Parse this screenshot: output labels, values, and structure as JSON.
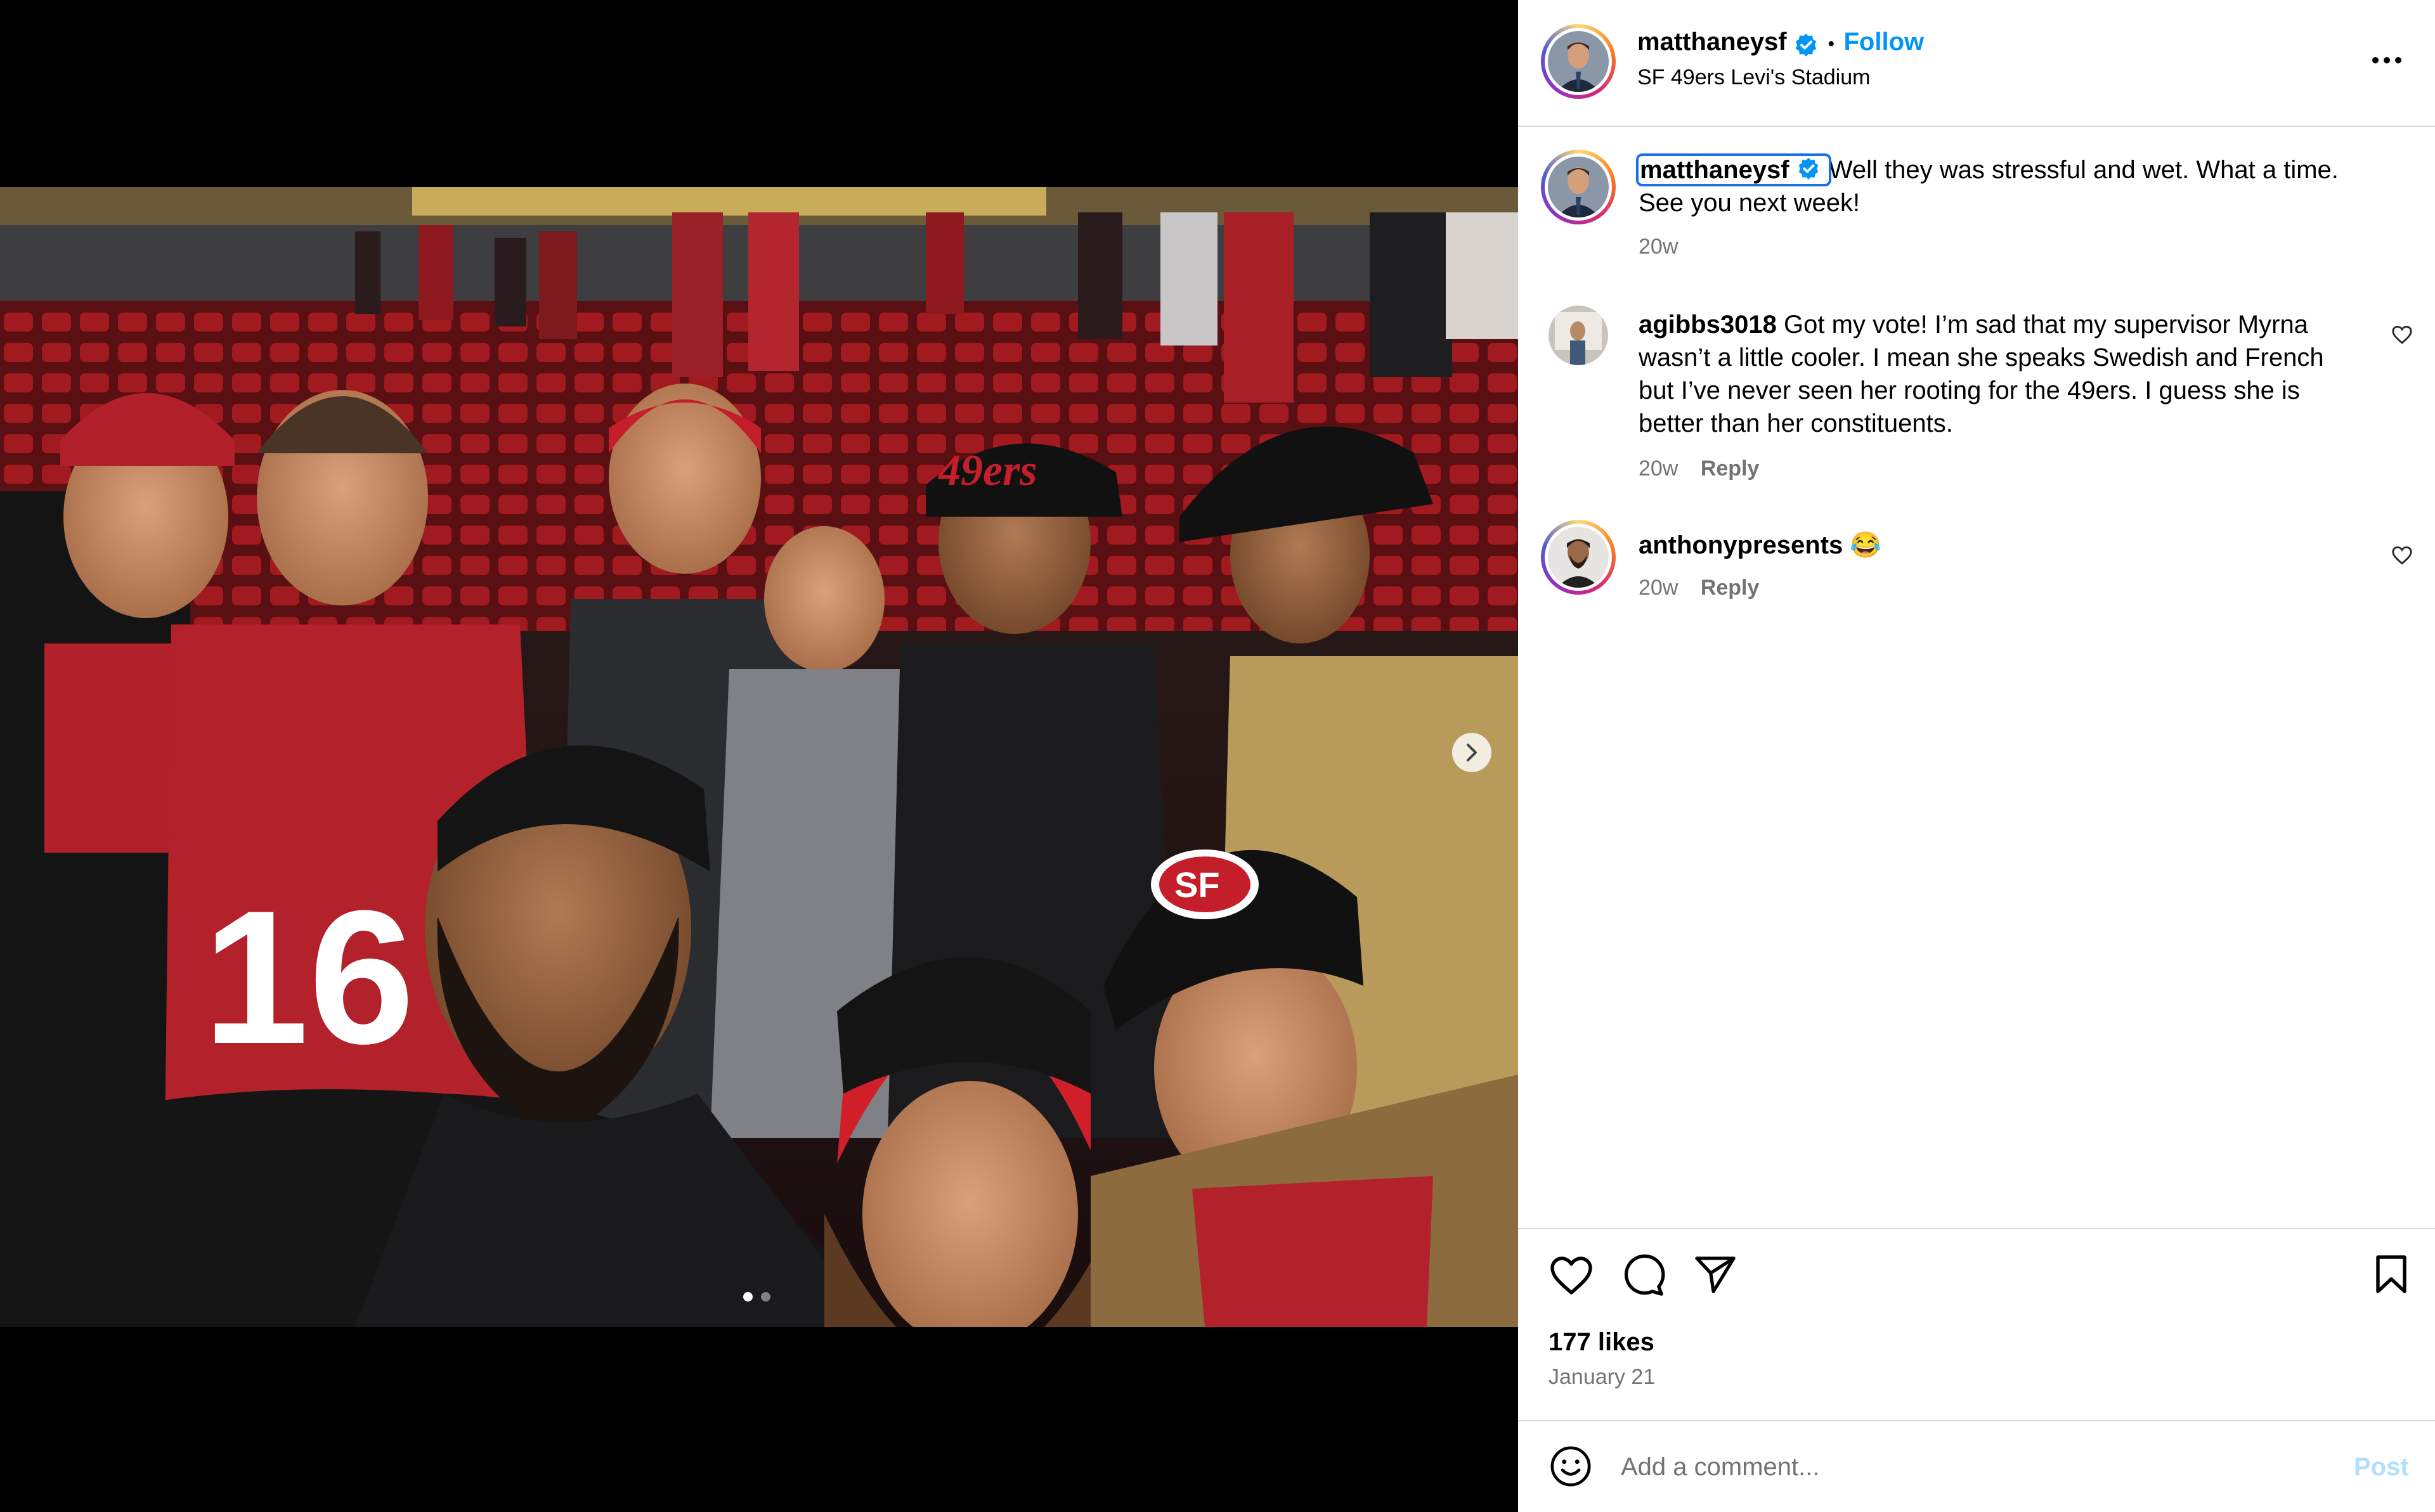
{
  "post": {
    "username": "matthaneysf",
    "location": "SF 49ers Levi's Stadium",
    "follow_label": "Follow",
    "separator": "•",
    "more_icon": "more-options-icon"
  },
  "caption": {
    "username": "matthaneysf",
    "text_line1": "Well they was stressful and wet. What a time.",
    "text_line2": "See you next week!",
    "time": "20w"
  },
  "comments": [
    {
      "username": "agibbs3018",
      "line1": "Got my vote! I’m sad that my supervisor Myrna",
      "line2": "wasn’t a little cooler. I mean she speaks Swedish and French",
      "line3": "but I’ve never seen her rooting for the 49ers. I guess she is",
      "line4": "better than her constituents.",
      "time": "20w",
      "reply_label": "Reply"
    },
    {
      "username": "anthonypresents",
      "text": "😂",
      "time": "20w",
      "reply_label": "Reply"
    }
  ],
  "footer": {
    "likes": "177 likes",
    "date": "January 21",
    "comment_placeholder": "Add a comment...",
    "post_label": "Post"
  },
  "colors": {
    "accent": "#0095f6",
    "verified": "#0095f6",
    "niners_red": "#c41e2b",
    "muted": "#737373"
  },
  "carousel": {
    "current_slide": 1,
    "total_slides": 2
  }
}
